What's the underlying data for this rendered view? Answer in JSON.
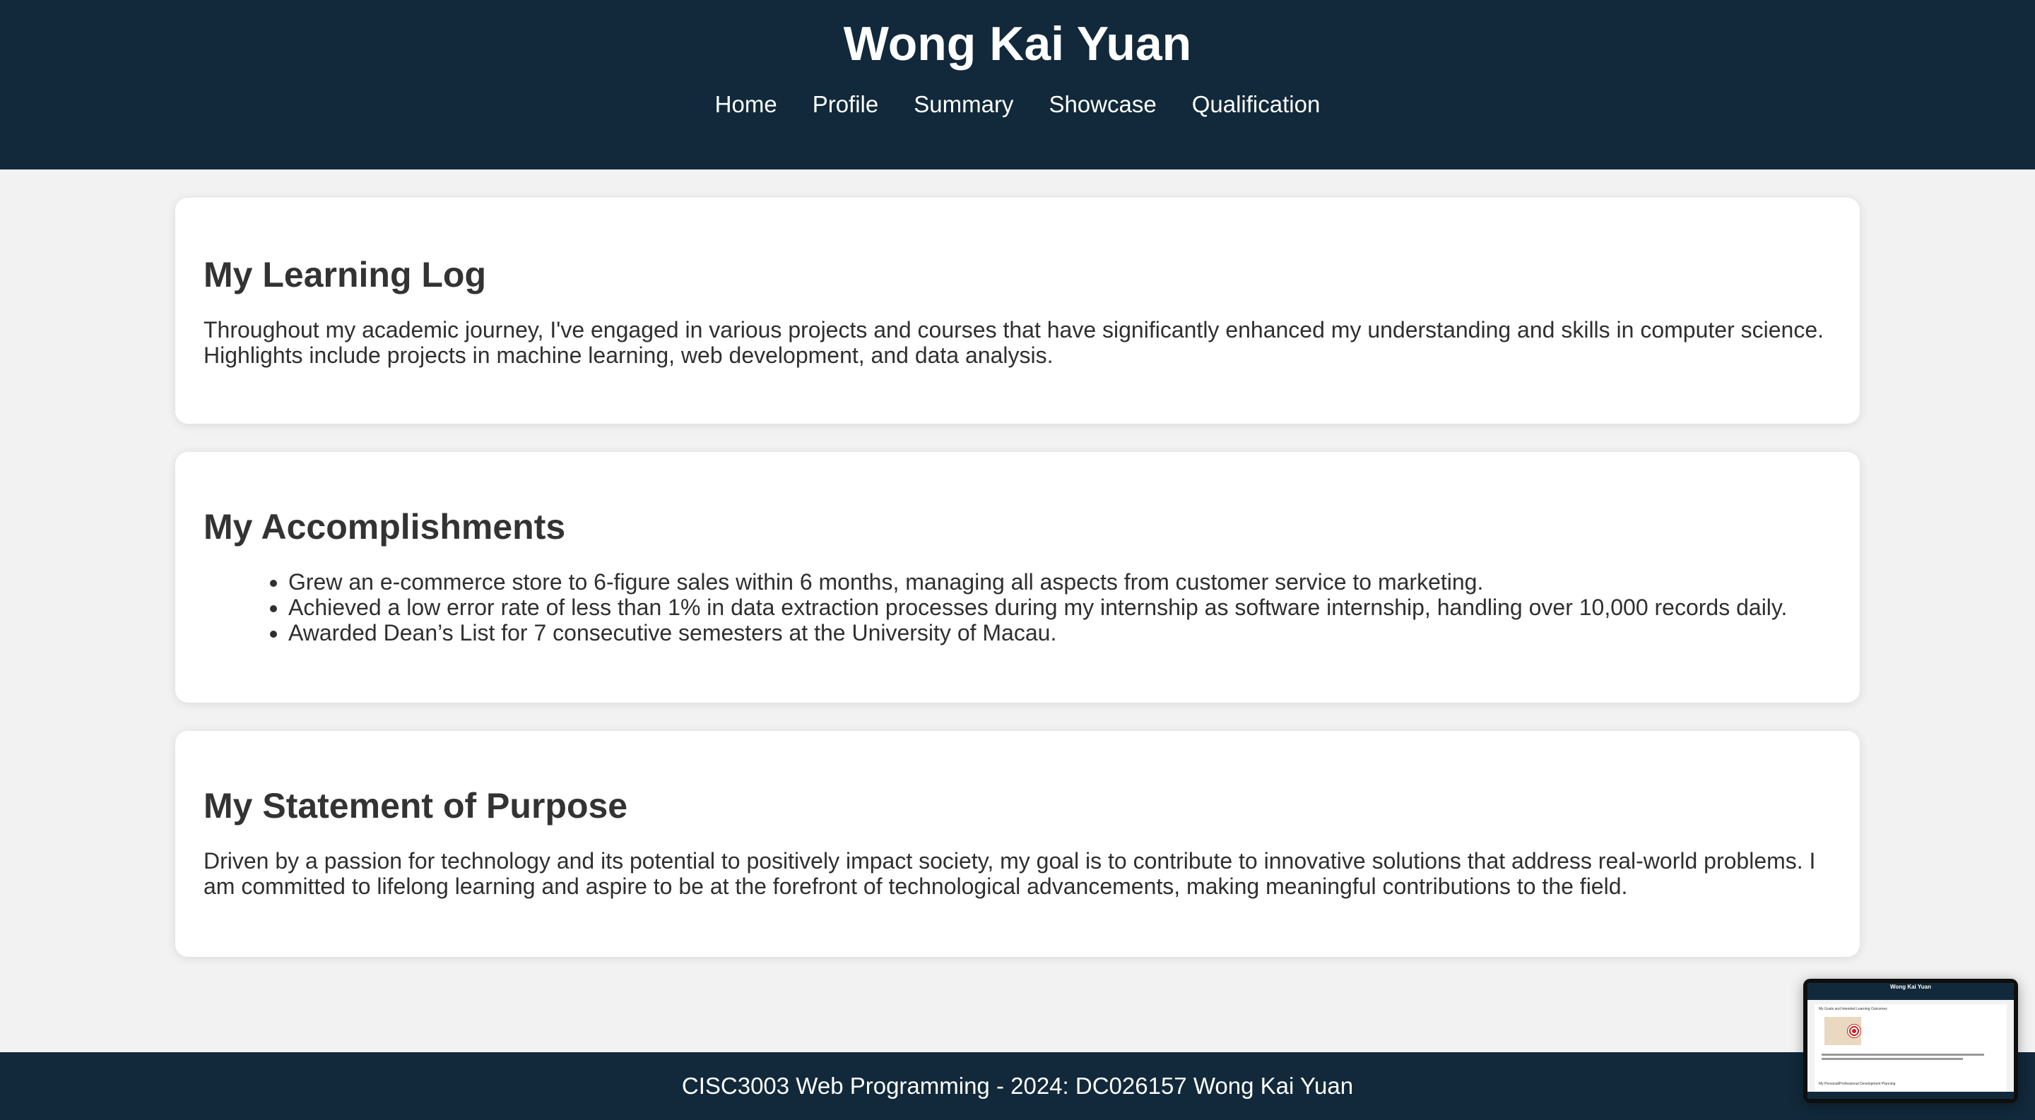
{
  "header": {
    "title": "Wong Kai Yuan",
    "nav": [
      "Home",
      "Profile",
      "Summary",
      "Showcase",
      "Qualification"
    ]
  },
  "sections": [
    {
      "heading": "My Learning Log",
      "paragraph": "Throughout my academic journey, I've engaged in various projects and courses that have significantly enhanced my understanding and skills in computer science. Highlights include projects in machine learning, web development, and data analysis."
    },
    {
      "heading": "My Accomplishments",
      "items": [
        "Grew an e-commerce store to 6-figure sales within 6 months, managing all aspects from customer service to marketing.",
        "Achieved a low error rate of less than 1% in data extraction processes during my internship as software internship, handling over 10,000 records daily.",
        "Awarded Dean’s List for 7 consecutive semesters at the University of Macau."
      ]
    },
    {
      "heading": "My Statement of Purpose",
      "paragraph": "Driven by a passion for technology and its potential to positively impact society, my goal is to contribute to innovative solutions that address real-world problems. I am committed to lifelong learning and aspire to be at the forefront of technological advancements, making meaningful contributions to the field."
    }
  ],
  "footer": {
    "text": "CISC3003 Web Programming - 2024: DC026157 Wong Kai Yuan"
  },
  "preview": {
    "title": "Wong Kai Yuan",
    "heading": "My Goals and Intended Learning Outcomes",
    "subheading": "My Personal/Professional Development Planning"
  },
  "colors": {
    "header_bg": "#11293a",
    "page_bg": "#f2f2f2",
    "card_bg": "#ffffff"
  }
}
